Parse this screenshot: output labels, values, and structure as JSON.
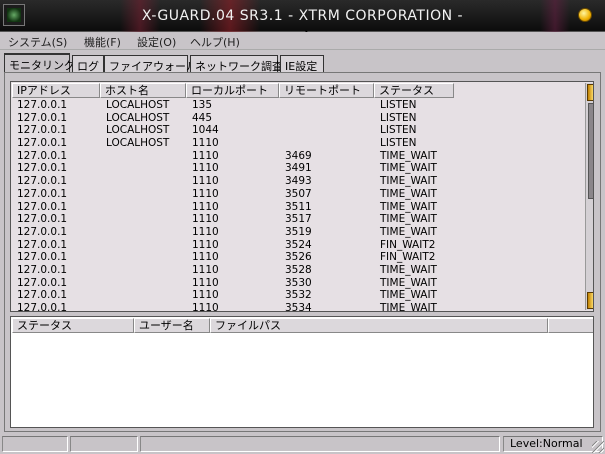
{
  "window": {
    "title": "X-GUARD.04 SR3.1 - XTRM CORPORATION -"
  },
  "menu": [
    "システム(S)",
    "機能(F)",
    "設定(O)",
    "ヘルプ(H)"
  ],
  "tabs": [
    "モニタリング",
    "ログ",
    "ファイアウォール",
    "ネットワーク調査",
    "IE設定"
  ],
  "active_tab": "モニタリング",
  "connections": {
    "columns": [
      "IPアドレス",
      "ホスト名",
      "ローカルポート",
      "リモートポート",
      "ステータス"
    ],
    "rows": [
      [
        "127.0.0.1",
        "LOCALHOST",
        "135",
        "",
        "LISTEN"
      ],
      [
        "127.0.0.1",
        "LOCALHOST",
        "445",
        "",
        "LISTEN"
      ],
      [
        "127.0.0.1",
        "LOCALHOST",
        "1044",
        "",
        "LISTEN"
      ],
      [
        "127.0.0.1",
        "LOCALHOST",
        "1110",
        "",
        "LISTEN"
      ],
      [
        "127.0.0.1",
        "",
        "1110",
        "3469",
        "TIME_WAIT"
      ],
      [
        "127.0.0.1",
        "",
        "1110",
        "3491",
        "TIME_WAIT"
      ],
      [
        "127.0.0.1",
        "",
        "1110",
        "3493",
        "TIME_WAIT"
      ],
      [
        "127.0.0.1",
        "",
        "1110",
        "3507",
        "TIME_WAIT"
      ],
      [
        "127.0.0.1",
        "",
        "1110",
        "3511",
        "TIME_WAIT"
      ],
      [
        "127.0.0.1",
        "",
        "1110",
        "3517",
        "TIME_WAIT"
      ],
      [
        "127.0.0.1",
        "",
        "1110",
        "3519",
        "TIME_WAIT"
      ],
      [
        "127.0.0.1",
        "",
        "1110",
        "3524",
        "FIN_WAIT2"
      ],
      [
        "127.0.0.1",
        "",
        "1110",
        "3526",
        "FIN_WAIT2"
      ],
      [
        "127.0.0.1",
        "",
        "1110",
        "3528",
        "TIME_WAIT"
      ],
      [
        "127.0.0.1",
        "",
        "1110",
        "3530",
        "TIME_WAIT"
      ],
      [
        "127.0.0.1",
        "",
        "1110",
        "3532",
        "TIME_WAIT"
      ],
      [
        "127.0.0.1",
        "",
        "1110",
        "3534",
        "TIME_WAIT"
      ]
    ]
  },
  "processes": {
    "columns": [
      "ステータス",
      "ユーザー名",
      "ファイルパス",
      ""
    ]
  },
  "status": {
    "cells": [
      "",
      "",
      "",
      "Level:Normal"
    ]
  },
  "colors": {
    "titlebar": "#111111",
    "list_bg": "#e6e0e4",
    "accent": "#f0b000"
  },
  "icons": [
    "app-icon",
    "minimize-icon",
    "mouse-pointer-icon",
    "scroll-up-icon",
    "scroll-down-icon",
    "resize-grip-icon"
  ]
}
